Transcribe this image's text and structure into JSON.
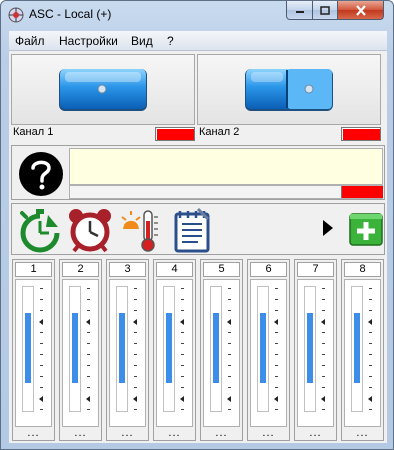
{
  "window": {
    "title": "ASC - Local (+)"
  },
  "menu": [
    "Файл",
    "Настройки",
    "Вид",
    "?"
  ],
  "channels": [
    {
      "label": "Канал 1",
      "status_color": "#ff0000",
      "switch_state": "off"
    },
    {
      "label": "Канал 2",
      "status_color": "#ff0000",
      "switch_state": "on"
    }
  ],
  "message_panel": {
    "icon": "question-icon",
    "text": "",
    "status_color": "#ff0000"
  },
  "toolbar": {
    "tools": [
      "stopwatch-icon",
      "alarm-clock-icon",
      "temperature-alarm-icon",
      "notepad-icon"
    ],
    "arrow": "triangle-right-icon",
    "add": "add-icon"
  },
  "strips": [
    {
      "number": "1",
      "dots": "...",
      "level": 0.62
    },
    {
      "number": "2",
      "dots": "...",
      "level": 0.62
    },
    {
      "number": "3",
      "dots": "...",
      "level": 0.62
    },
    {
      "number": "4",
      "dots": "...",
      "level": 0.62
    },
    {
      "number": "5",
      "dots": "...",
      "level": 0.62
    },
    {
      "number": "6",
      "dots": "...",
      "level": 0.62
    },
    {
      "number": "7",
      "dots": "...",
      "level": 0.62
    },
    {
      "number": "8",
      "dots": "...",
      "level": 0.62
    }
  ],
  "colors": {
    "accent": "#3c8ee8",
    "alarm": "#ff0000",
    "help_bg": "#ffffe1"
  }
}
